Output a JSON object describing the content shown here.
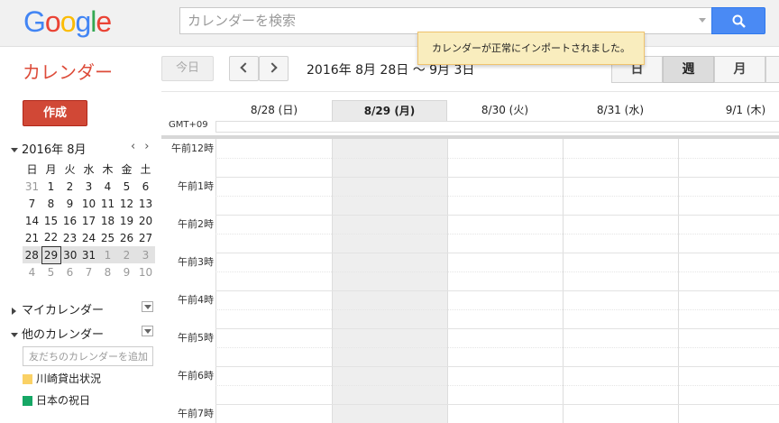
{
  "header": {
    "logo_letters": [
      {
        "ch": "G",
        "color": "#4285f4"
      },
      {
        "ch": "o",
        "color": "#ea4335"
      },
      {
        "ch": "o",
        "color": "#fbbc05"
      },
      {
        "ch": "g",
        "color": "#4285f4"
      },
      {
        "ch": "l",
        "color": "#34a853"
      },
      {
        "ch": "e",
        "color": "#ea4335"
      }
    ],
    "search_placeholder": "カレンダーを検索"
  },
  "toast": {
    "text": "カレンダーが正常にインポートされました。"
  },
  "toolbar": {
    "app_title": "カレンダー",
    "today_label": "今日",
    "date_range": "2016年 8月 28日 〜 9月 3日",
    "views": {
      "day": "日",
      "week": "週",
      "month": "月"
    }
  },
  "sidebar": {
    "create_label": "作成",
    "mini_title": "2016年 8月",
    "mini_prev": "‹",
    "mini_next": "›",
    "weekdays": [
      "日",
      "月",
      "火",
      "水",
      "木",
      "金",
      "土"
    ],
    "weeks": [
      [
        "31",
        "1",
        "2",
        "3",
        "4",
        "5",
        "6"
      ],
      [
        "7",
        "8",
        "9",
        "10",
        "11",
        "12",
        "13"
      ],
      [
        "14",
        "15",
        "16",
        "17",
        "18",
        "19",
        "20"
      ],
      [
        "21",
        "22",
        "23",
        "24",
        "25",
        "26",
        "27"
      ],
      [
        "28",
        "29",
        "30",
        "31",
        "1",
        "2",
        "3"
      ],
      [
        "4",
        "5",
        "6",
        "7",
        "8",
        "9",
        "10"
      ]
    ],
    "my_calendars": "マイカレンダー",
    "other_calendars": "他のカレンダー",
    "add_friend_placeholder": "友だちのカレンダーを追加",
    "calendars": [
      {
        "name": "川崎貸出状況",
        "color": "#fad165"
      },
      {
        "name": "日本の祝日",
        "color": "#16a765"
      }
    ]
  },
  "grid": {
    "timezone": "GMT+09",
    "days": [
      "8/28 (日)",
      "8/29 (月)",
      "8/30 (火)",
      "8/31 (水)",
      "9/1 (木)"
    ],
    "hours": [
      "午前12時",
      "午前1時",
      "午前2時",
      "午前3時",
      "午前4時",
      "午前5時",
      "午前6時",
      "午前7時"
    ]
  }
}
